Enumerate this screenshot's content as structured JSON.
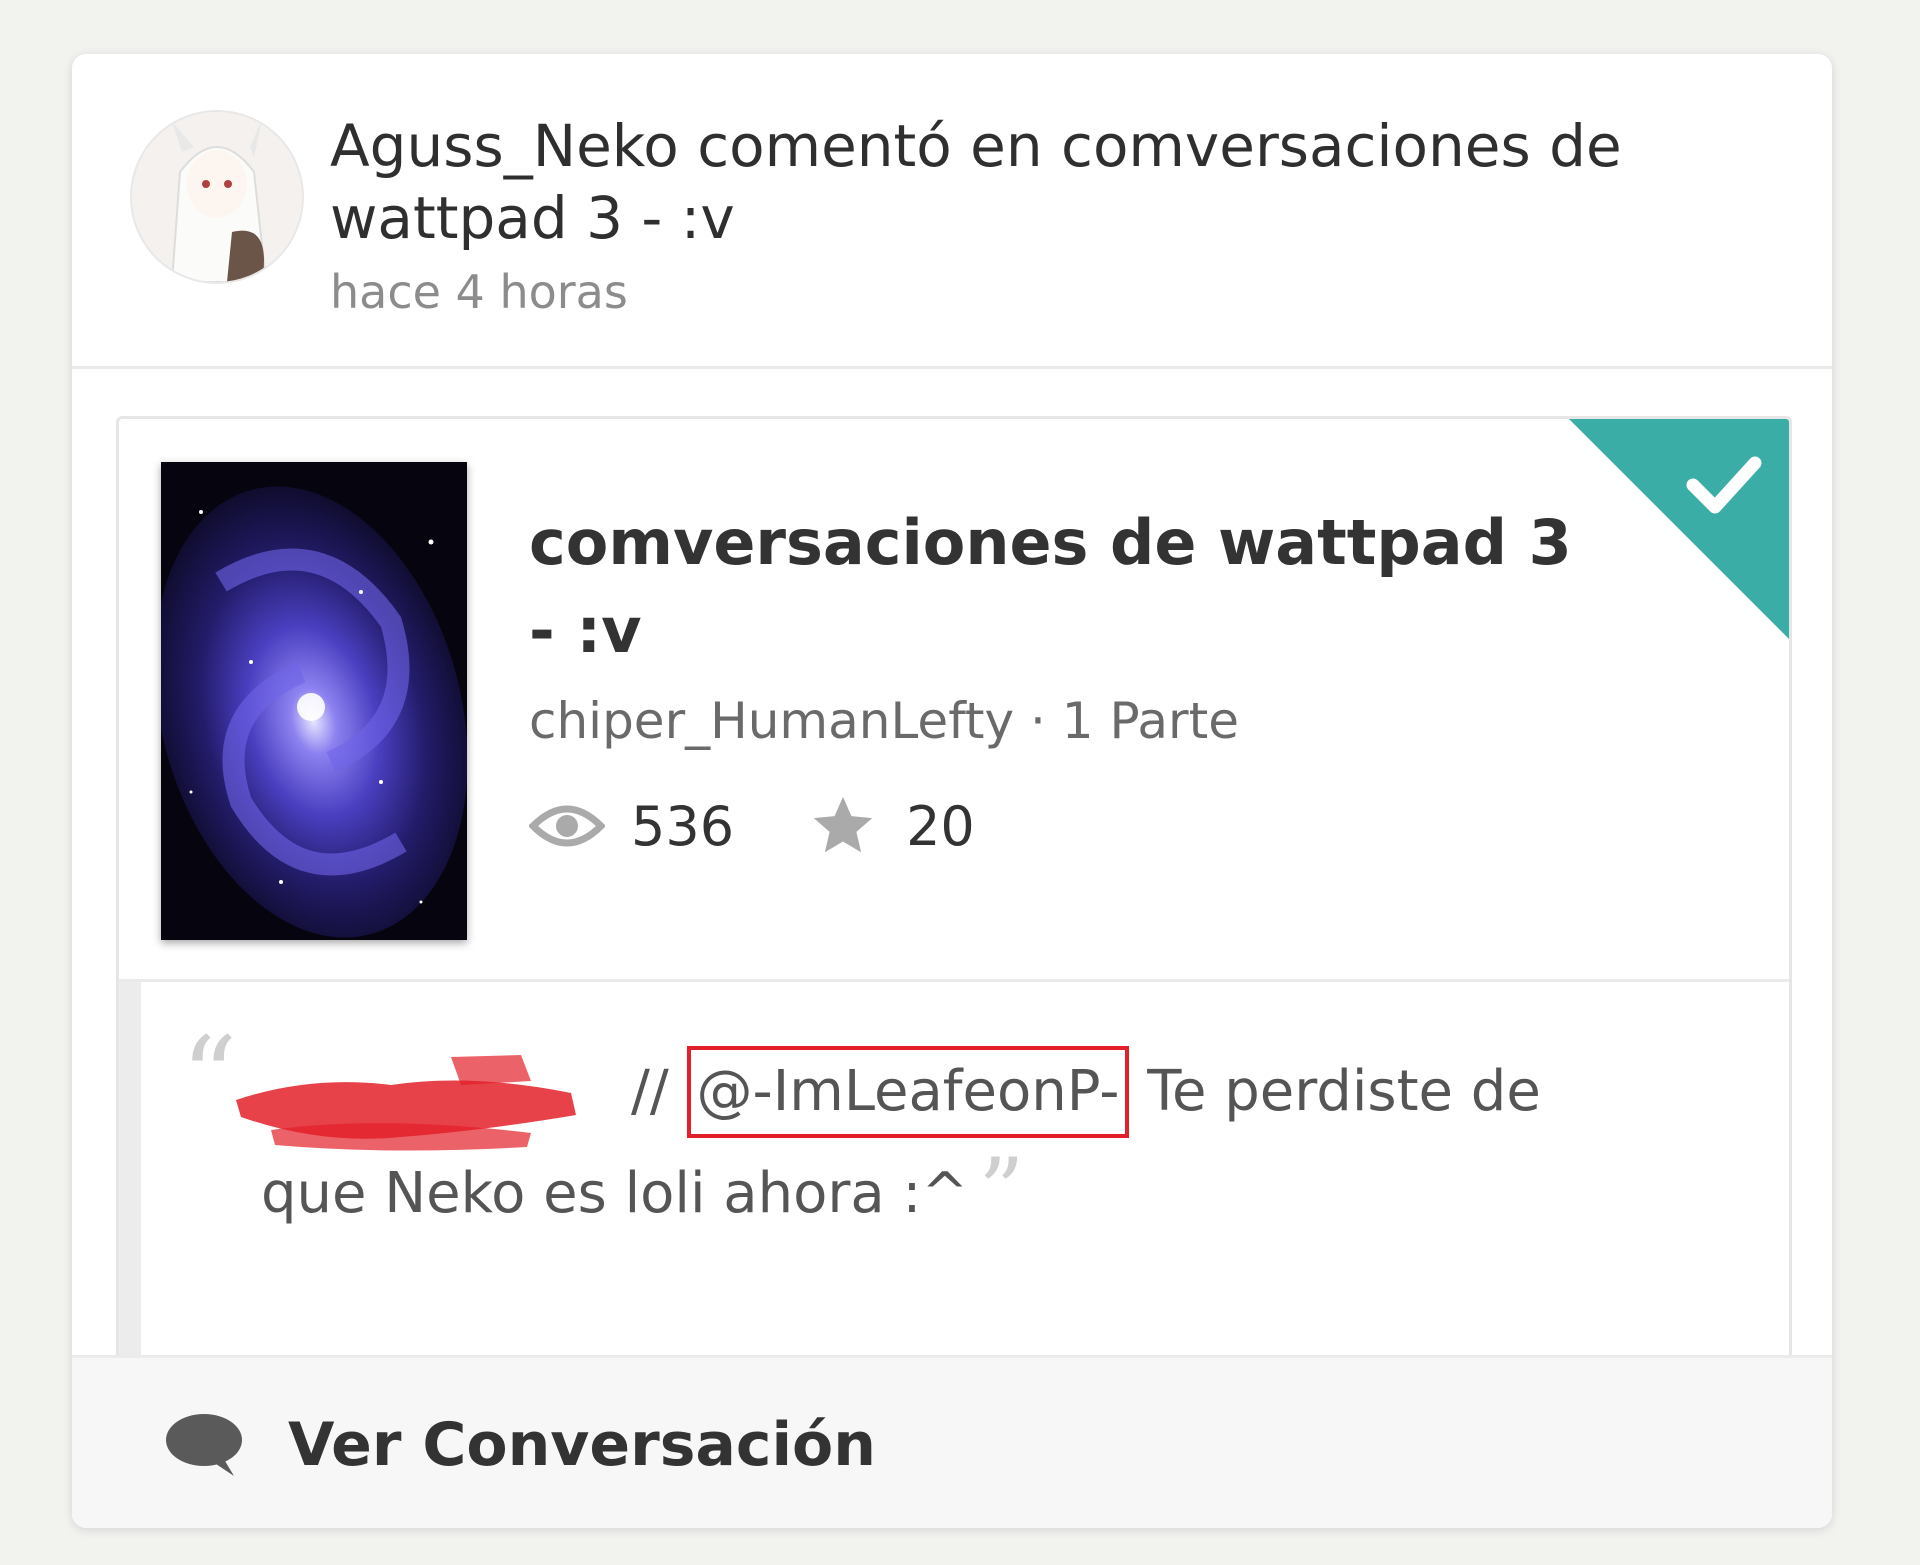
{
  "header": {
    "title": "Aguss_Neko comentó en comversaciones de wattpad 3 - :v",
    "time": "hace 4 horas"
  },
  "story": {
    "title": "comversaciones de wattpad 3 - :v",
    "meta": "chiper_HumanLefty · 1 Parte",
    "reads": "536",
    "votes": "20",
    "in_library_icon": "check-icon",
    "accent_color": "#3aaea6"
  },
  "comment": {
    "mention": "@-ImLeafeonP-",
    "separator": "//",
    "text_part1": "Te perdiste de",
    "text_part2": "que Neko es loli ahora :^"
  },
  "footer": {
    "link_label": "Ver Conversación",
    "icon": "speech-bubble-icon"
  },
  "colors": {
    "redaction": "#e3202a",
    "highlight_box": "#e3202a"
  }
}
